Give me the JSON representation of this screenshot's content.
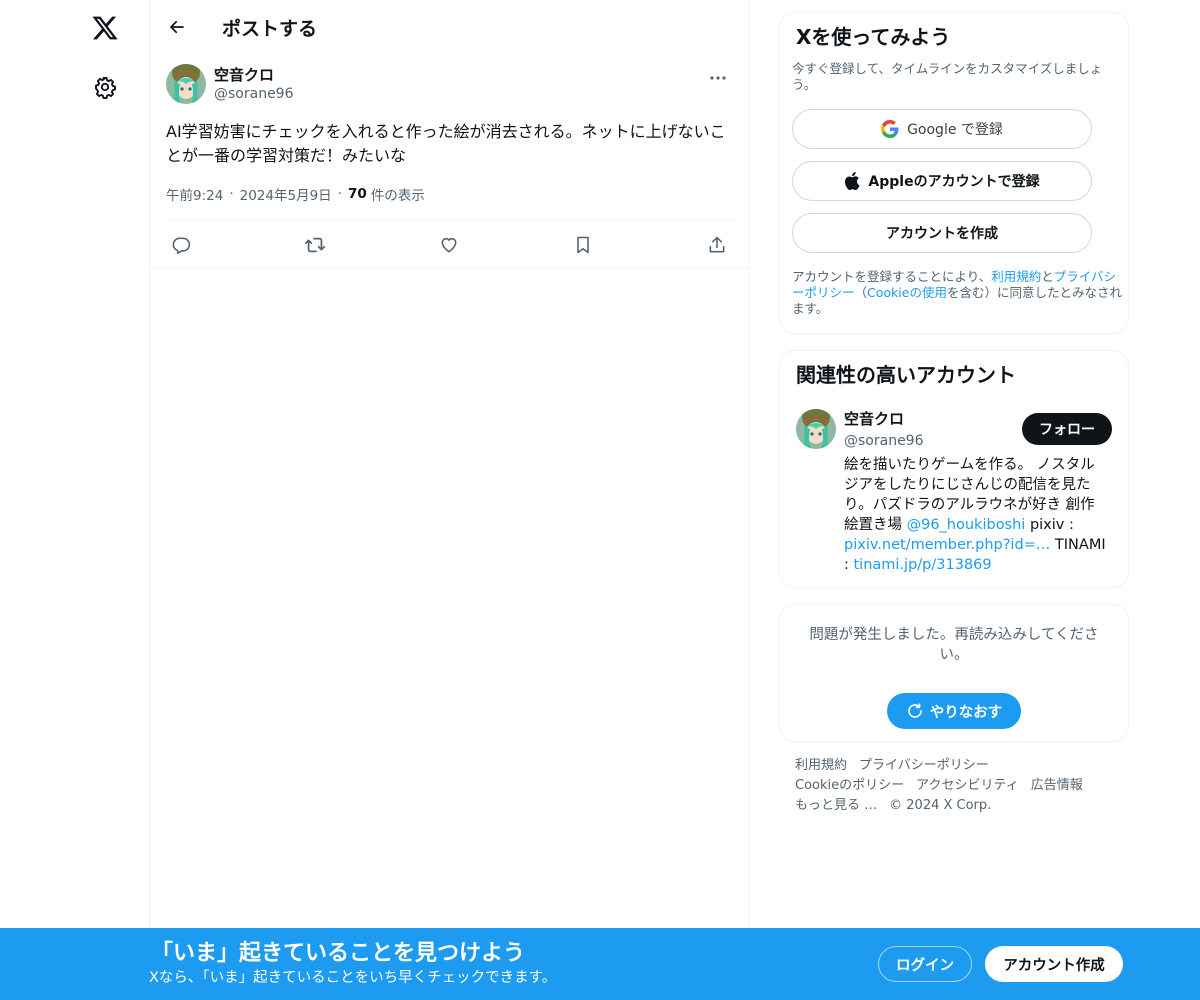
{
  "colors": {
    "accent": "#1d9bf0",
    "text_primary": "#0f1419",
    "text_secondary": "#536471",
    "border": "#eff3f4",
    "banner_bg": "#1d9bf0"
  },
  "leftnav": {
    "logo_icon": "x-logo-icon",
    "settings_icon": "gear-icon"
  },
  "header": {
    "back_icon": "arrow-left-icon",
    "title": "ポストする"
  },
  "post": {
    "author_name": "空音クロ",
    "author_handle": "@sorane96",
    "text": "AI学習妨害にチェックを入れると作った絵が消去される。ネットに上げないことが一番の学習対策だ！みたいな",
    "time": "午前9:24",
    "date": "2024年5月9日",
    "separator": "·",
    "views_count": "70",
    "views_label": "件の表示",
    "actions": [
      "reply-icon",
      "repost-icon",
      "like-icon",
      "bookmark-icon",
      "share-icon"
    ]
  },
  "signup": {
    "title": "Xを使ってみよう",
    "subtitle": "今すぐ登録して、タイムラインをカスタマイズしましょう。",
    "google_label": "Google で登録",
    "apple_label": "Appleのアカウントで登録",
    "create_label": "アカウントを作成",
    "terms_before": "アカウントを登録することにより、",
    "terms_link1": "利用規約",
    "terms_and": "と",
    "terms_link2": "プライバシーポリシー",
    "terms_paren_open": "（",
    "terms_link3": "Cookieの使用",
    "terms_after": "を含む）に同意したとみなされます。"
  },
  "related": {
    "title": "関連性の高いアカウント",
    "name": "空音クロ",
    "handle": "@sorane96",
    "follow_label": "フォロー",
    "bio_1": "絵を描いたりゲームを作る。 ノスタルジアをしたりにじさんじの配信を見たり。パズドラのアルラウネが好き 創作絵置き場 ",
    "bio_link1": "@96_houkiboshi",
    "bio_2": " pixiv : ",
    "bio_link2": "pixiv.net/member.php?id=…",
    "bio_3": " TINAMI : ",
    "bio_link3": "tinami.jp/p/313869"
  },
  "error": {
    "message": "問題が発生しました。再読み込みしてください。",
    "retry_label": "やりなおす"
  },
  "footer": {
    "links": [
      "利用規約",
      "プライバシーポリシー",
      "Cookieのポリシー",
      "アクセシビリティ",
      "広告情報",
      "もっと見る …",
      "© 2024 X Corp."
    ]
  },
  "banner": {
    "title": "「いま」起きていることを見つけよう",
    "subtitle": "Xなら、「いま」起きていることをいち早くチェックできます。",
    "login_label": "ログイン",
    "signup_label": "アカウント作成"
  }
}
